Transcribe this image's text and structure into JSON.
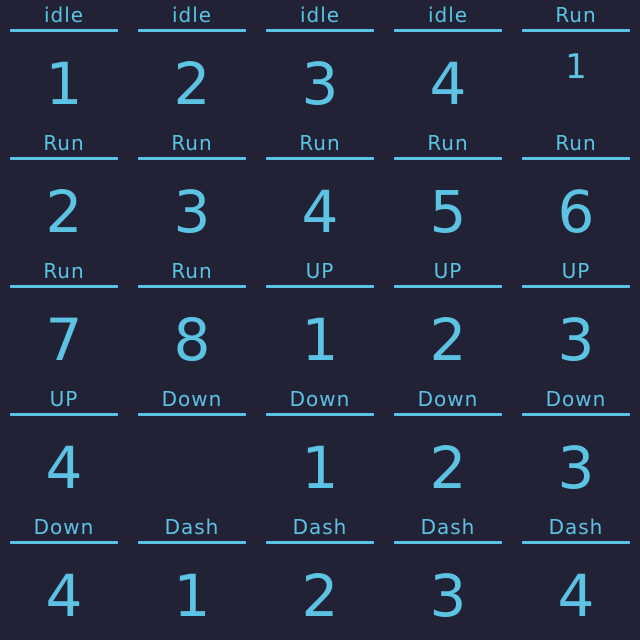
{
  "colors": {
    "background": "#222236",
    "ink": "#5cc3e3"
  },
  "cells": [
    {
      "label": "idle",
      "frame": "1"
    },
    {
      "label": "idle",
      "frame": "2"
    },
    {
      "label": "idle",
      "frame": "3"
    },
    {
      "label": "idle",
      "frame": "4"
    },
    {
      "label": "Run",
      "frame": "1"
    },
    {
      "label": "Run",
      "frame": "2"
    },
    {
      "label": "Run",
      "frame": "3"
    },
    {
      "label": "Run",
      "frame": "4"
    },
    {
      "label": "Run",
      "frame": "5"
    },
    {
      "label": "Run",
      "frame": "6"
    },
    {
      "label": "Run",
      "frame": "7"
    },
    {
      "label": "Run",
      "frame": "8"
    },
    {
      "label": "UP",
      "frame": "1"
    },
    {
      "label": "UP",
      "frame": "2"
    },
    {
      "label": "UP",
      "frame": "3"
    },
    {
      "label": "UP",
      "frame": "4"
    },
    {
      "label": "Down",
      "frame": ""
    },
    {
      "label": "Down",
      "frame": "1"
    },
    {
      "label": "Down",
      "frame": "2"
    },
    {
      "label": "Down",
      "frame": "3"
    },
    {
      "label": "Down",
      "frame": "4"
    },
    {
      "label": "Dash",
      "frame": "1"
    },
    {
      "label": "Dash",
      "frame": "2"
    },
    {
      "label": "Dash",
      "frame": "3"
    },
    {
      "label": "Dash",
      "frame": "4"
    }
  ]
}
